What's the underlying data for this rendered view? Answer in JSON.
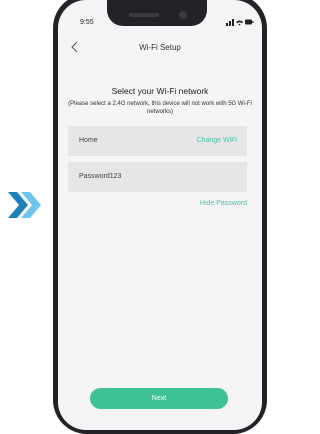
{
  "status": {
    "time": "9:55"
  },
  "header": {
    "title": "Wi-Fi Setup"
  },
  "main": {
    "heading": "Select your Wi-Fi network",
    "note": "(Please select a 2.4G network, this device will not work with 5G Wi-Fi networks)",
    "wifi": {
      "ssid": "Home",
      "change_label": "Change WiFi"
    },
    "password": {
      "value": "Password123",
      "toggle_label": "Hide Password"
    },
    "next_label": "Next"
  },
  "colors": {
    "accent": "#3fc396",
    "link": "#4cc3a0",
    "chevron": "#3aa7d6"
  },
  "icons": {
    "back": "chevron-left-icon",
    "forward": "double-chevron-right-icon"
  }
}
